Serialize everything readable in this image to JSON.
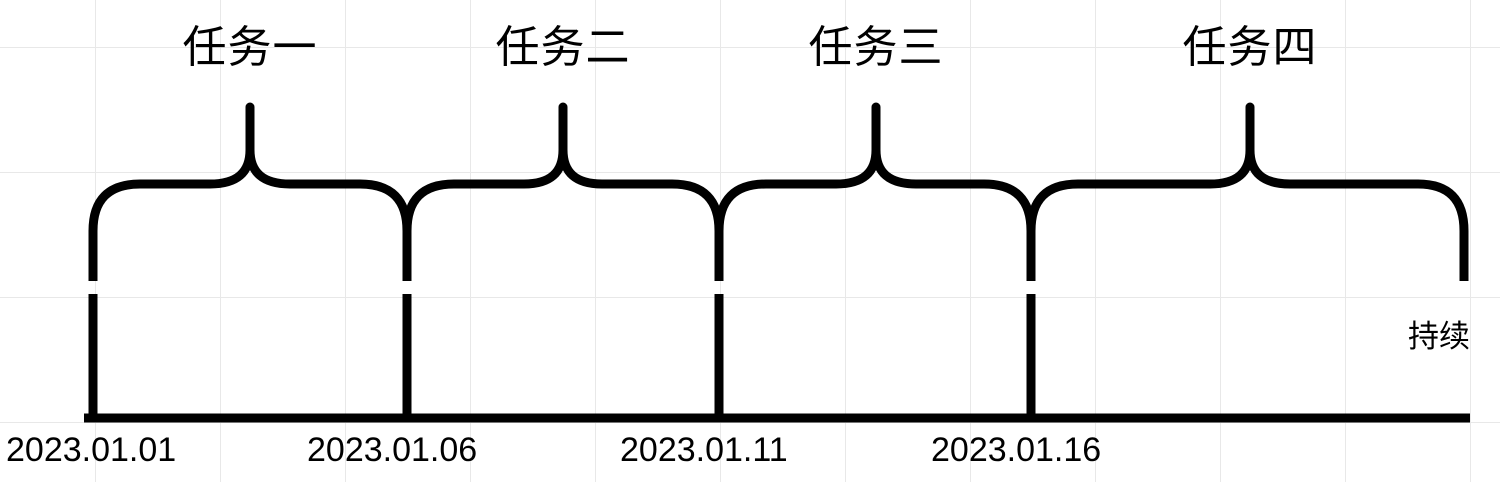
{
  "tasks": [
    {
      "label": "任务一"
    },
    {
      "label": "任务二"
    },
    {
      "label": "任务三"
    },
    {
      "label": "任务四"
    }
  ],
  "dates": [
    "2023.01.01",
    "2023.01.06",
    "2023.01.11",
    "2023.01.16"
  ],
  "ongoing_label": "持续",
  "colors": {
    "stroke": "#000000",
    "grid": "#e8e8e8",
    "background": "#ffffff"
  }
}
